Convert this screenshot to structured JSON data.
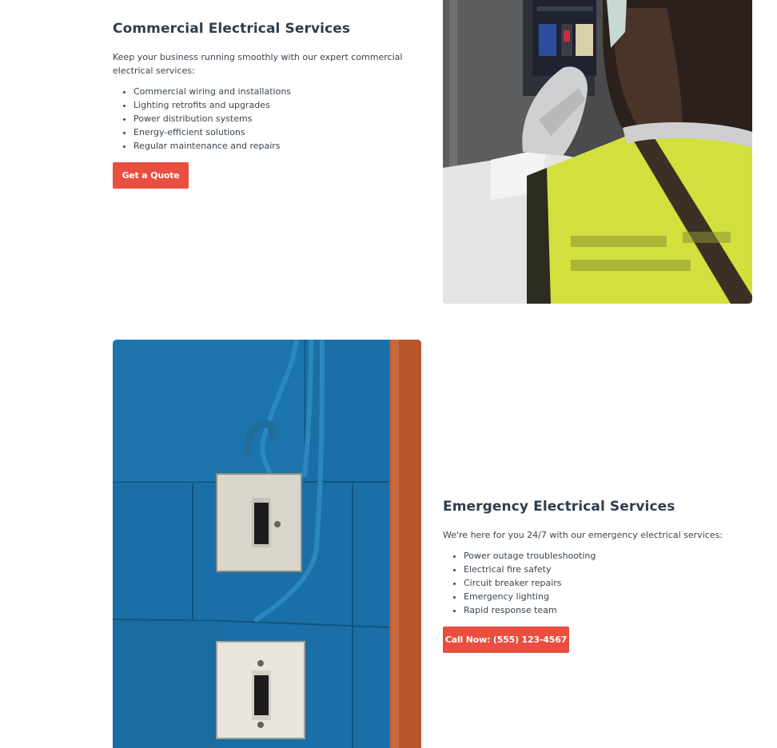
{
  "commercial": {
    "title": "Commercial Electrical Services",
    "intro": "Keep your business running smoothly with our expert commercial electrical services:",
    "items": [
      "Commercial wiring and installations",
      "Lighting retrofits and upgrades",
      "Power distribution systems",
      "Energy-efficient solutions",
      "Regular maintenance and repairs"
    ],
    "cta_label": "Get a Quote"
  },
  "emergency": {
    "title": "Emergency Electrical Services",
    "intro": "We're here for you 24/7 with our emergency electrical services:",
    "items": [
      "Power outage troubleshooting",
      "Electrical fire safety",
      "Circuit breaker repairs",
      "Emergency lighting",
      "Rapid response team"
    ],
    "cta_label": "Call Now: (555) 123-4567"
  },
  "colors": {
    "accent": "#e94e3f",
    "heading": "#2f3e4f",
    "body_text": "#3b4450"
  }
}
